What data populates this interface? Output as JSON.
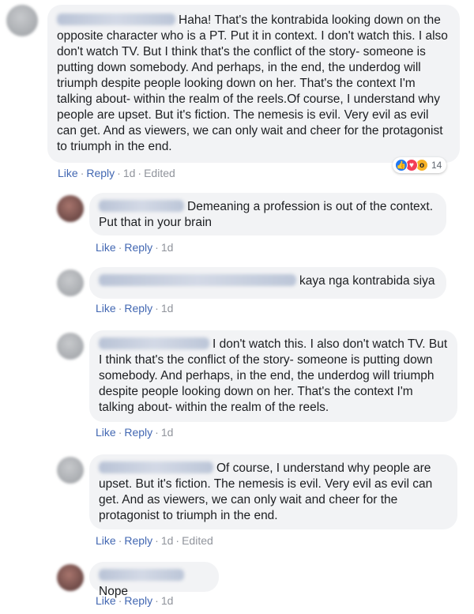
{
  "comments": [
    {
      "text": "Haha! That's the kontrabida looking down on the opposite character who is a PT. Put it in context. I don't watch this. I also don't watch TV. But I think that's the conflict of the story- someone is putting down somebody. And perhaps, in the end, the underdog will triumph despite people looking down on her. That's the context I'm talking about- within the realm of the reels.Of course, I understand why people are upset. But it's fiction. The nemesis is evil. Very evil as evil can get. And as viewers, we can only wait and cheer for the protagonist to triumph in the end.",
      "like": "Like",
      "reply": "Reply",
      "time": "1d",
      "edited": "Edited",
      "reactions": {
        "icons": [
          "like-icon",
          "love-icon",
          "wow-icon"
        ],
        "count": "14"
      }
    },
    {
      "text": "Demeaning a profession is out of the context. Put that in your brain",
      "like": "Like",
      "reply": "Reply",
      "time": "1d"
    },
    {
      "text": "kaya nga kontrabida siya",
      "like": "Like",
      "reply": "Reply",
      "time": "1d"
    },
    {
      "text": "I don't watch this. I also don't watch TV. But I think that's the conflict of the story- someone is putting down somebody. And perhaps, in the end, the underdog will triumph despite people looking down on her. That's the context I'm talking about- within the realm of the reels.",
      "like": "Like",
      "reply": "Reply",
      "time": "1d"
    },
    {
      "text": "Of course, I understand why people are upset. But it's fiction. The nemesis is evil. Very evil as evil can get. And as viewers, we can only wait and cheer for the protagonist to triumph in the end.",
      "like": "Like",
      "reply": "Reply",
      "time": "1d",
      "edited": "Edited"
    },
    {
      "text": "Nope",
      "like": "Like",
      "reply": "Reply",
      "time": "1d"
    }
  ],
  "colors": {
    "link": "#4267b2",
    "meta": "#90949c",
    "bubble": "#f2f3f5",
    "like": "#2078f4",
    "love": "#f33e58",
    "wow": "#f7b125"
  }
}
